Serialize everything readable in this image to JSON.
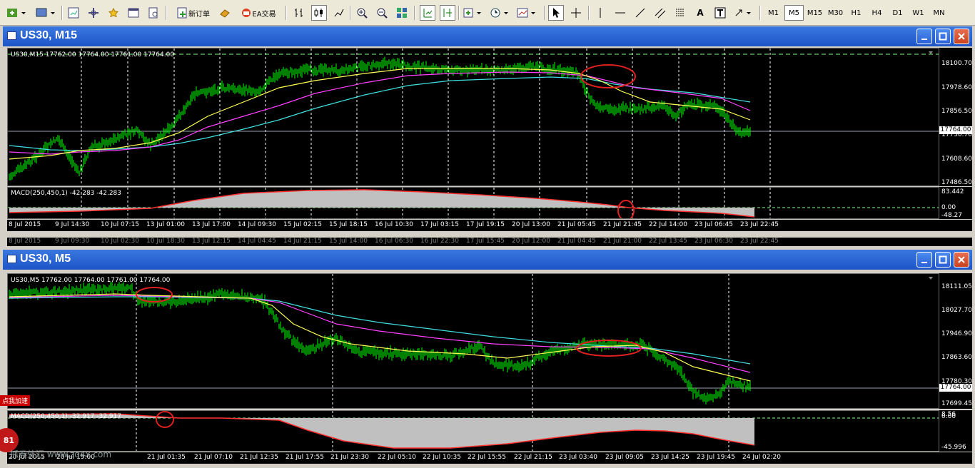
{
  "toolbar": {
    "new_order_label": "新订单",
    "ea_trading_label": "EA交易",
    "timeframes": [
      "M1",
      "M5",
      "M15",
      "M30",
      "H1",
      "H4",
      "D1",
      "W1",
      "MN"
    ],
    "active_timeframe": "M5"
  },
  "windows": [
    {
      "title": "US30, M15",
      "ohlc_label": "US30,M15  17762.00 17764.00 17761.00 17764.00",
      "price_labels": [
        "18100.70",
        "17978.60",
        "17856.50",
        "17730.70",
        "17608.60",
        "17486.50"
      ],
      "current_price": "17764.00",
      "macd_label": "MACD(250,450,1) -42.283 -42.283",
      "macd_labels": [
        "83.442",
        "0.00",
        "-48.27"
      ],
      "time_labels": [
        "8 Jul 2015",
        "9 Jul 14:30",
        "10 Jul 07:15",
        "13 Jul 01:00",
        "13 Jul 17:00",
        "14 Jul 09:30",
        "15 Jul 02:15",
        "15 Jul 18:15",
        "16 Jul 10:30",
        "17 Jul 03:15",
        "17 Jul 19:15",
        "20 Jul 13:00",
        "21 Jul 05:45",
        "21 Jul 21:45",
        "22 Jul 14:00",
        "23 Jul 06:45",
        "23 Jul 22:45"
      ],
      "time_labels_hidden": [
        "8 Jul 2015",
        "9 Jul 09:30",
        "10 Jul 02:30",
        "10 Jul 18:30",
        "13 Jul 12:15",
        "14 Jul 04:45",
        "14 Jul 21:15",
        "15 Jul 14:00",
        "16 Jul 06:30",
        "16 Jul 22:30",
        "17 Jul 15:45",
        "20 Jul 12:00",
        "21 Jul 04:45",
        "21 Jul 21:00",
        "22 Jul 13:45",
        "23 Jul 06:30",
        "23 Jul 22:45"
      ]
    },
    {
      "title": "US30, M5",
      "ohlc_label": "US30,M5  17762.00 17764.00 17761.00 17764.00",
      "price_labels": [
        "18111.05",
        "18027.70",
        "17946.90",
        "17863.60",
        "17780.30",
        "17699.45"
      ],
      "current_price": "17764.00",
      "macd_label": "MACD(250,450,1) -32.917 -32.917",
      "macd_labels": [
        "8.56",
        "0.00",
        "-45.996"
      ],
      "time_labels": [
        "20 Jul 2015",
        "20 Jul 19:00",
        "21 Jul 01:35",
        "21 Jul 07:10",
        "21 Jul 12:35",
        "21 Jul 17:55",
        "21 Jul 23:30",
        "22 Jul 05:10",
        "22 Jul 10:35",
        "22 Jul 15:55",
        "22 Jul 21:15",
        "23 Jul 03:40",
        "23 Jul 09:05",
        "23 Jul 14:25",
        "23 Jul 19:45",
        "24 Jul 02:20"
      ]
    }
  ],
  "overlay": {
    "badge_text": "点我加速",
    "badge_number": "81",
    "watermark": "抓券外汇 www.zq4x.com"
  },
  "colors": {
    "bull": "#00ff00",
    "ma_fast": "#ffff55",
    "ma_mid": "#ff40ff",
    "ma_slow": "#40e0e0",
    "macd": "#c0c0c0",
    "signal": "#ff3030",
    "grid": "#ffffff"
  }
}
